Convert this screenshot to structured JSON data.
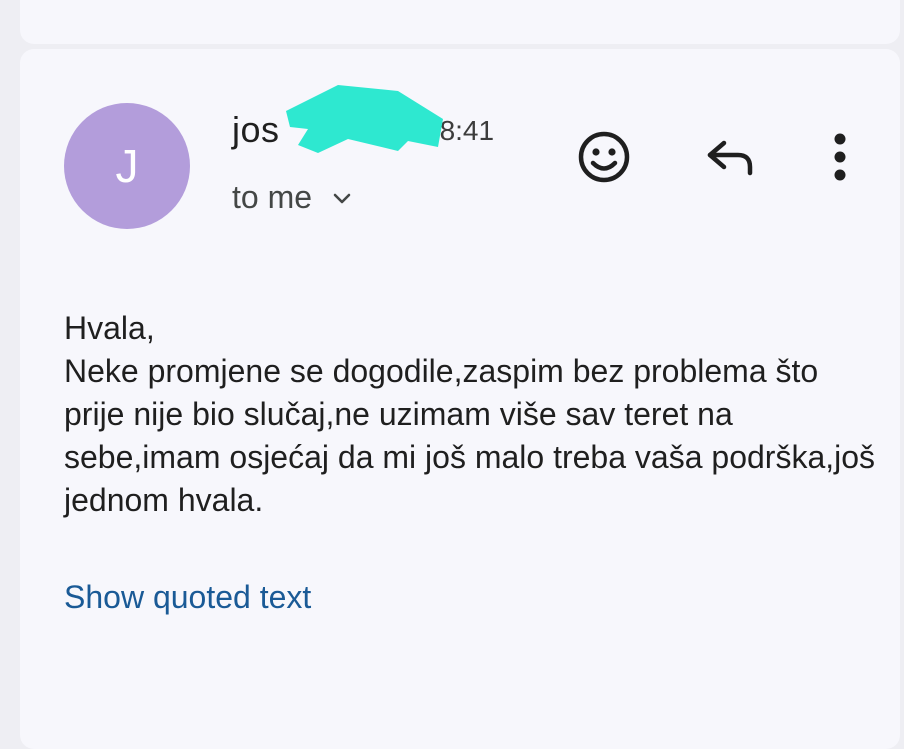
{
  "message": {
    "avatar_initial": "J",
    "sender_name": "jos",
    "time": "08:41",
    "recipient": "to me",
    "body_greeting": "Hvala,",
    "body_text": "Neke promjene se dogodile,zaspim bez problema što prije nije bio slučaj,ne uzimam više sav teret na sebe,imam osjećaj da mi još malo treba vaša podrška,još jednom hvala.",
    "show_quoted_label": "Show quoted text"
  },
  "icons": {
    "emoji": "smiley-face-icon",
    "reply": "reply-arrow-icon",
    "more": "more-vertical-icon",
    "recipient_expand": "chevron-down-icon"
  },
  "colors": {
    "avatar": "#b39ddb",
    "link": "#1a5a96",
    "redaction": "#2ee8d0",
    "background": "#f7f7fc"
  }
}
